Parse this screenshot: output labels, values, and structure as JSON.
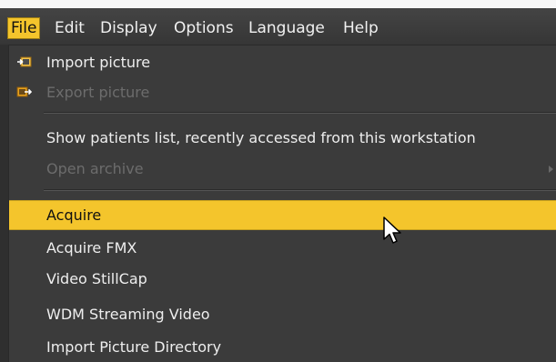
{
  "menubar": {
    "items": [
      {
        "label": "File",
        "active": true
      },
      {
        "label": "Edit"
      },
      {
        "label": "Display"
      },
      {
        "label": "Options"
      },
      {
        "label": "Language"
      },
      {
        "label": "Help"
      }
    ]
  },
  "file_menu": {
    "items": [
      {
        "label": "Import picture",
        "icon": "import-icon",
        "enabled": true
      },
      {
        "label": "Export picture",
        "icon": "export-icon",
        "enabled": false
      },
      {
        "label": "Show patients list, recently accessed from this workstation",
        "enabled": true
      },
      {
        "label": "Open archive",
        "enabled": false,
        "has_submenu": true
      },
      {
        "label": "Acquire",
        "enabled": true,
        "highlighted": true
      },
      {
        "label": "Acquire FMX",
        "enabled": true
      },
      {
        "label": "Video StillCap",
        "enabled": true
      },
      {
        "label": "WDM Streaming Video",
        "enabled": true
      },
      {
        "label": "Import Picture Directory",
        "enabled": true
      }
    ]
  },
  "colors": {
    "highlight": "#f4c52c",
    "menu_background": "#3b3b3b",
    "text": "#eeeeee",
    "disabled_text": "#6c6c6c",
    "icon_accent": "#e8a21c"
  }
}
